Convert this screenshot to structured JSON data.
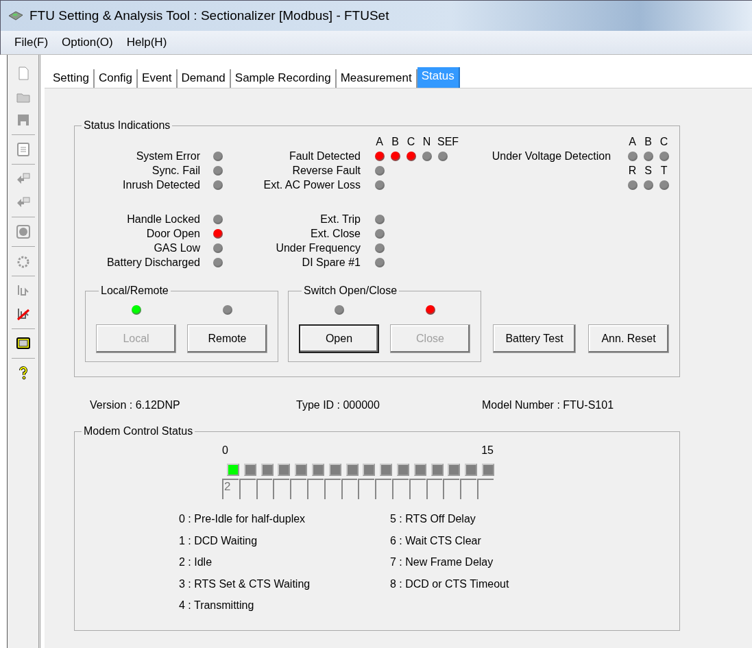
{
  "window": {
    "title": "FTU Setting & Analysis Tool : Sectionalizer [Modbus]  - FTUSet"
  },
  "menu": [
    "File(F)",
    "Option(O)",
    "Help(H)"
  ],
  "tabs": [
    {
      "label": "Setting",
      "selected": false
    },
    {
      "label": "Config",
      "selected": false
    },
    {
      "label": "Event",
      "selected": false
    },
    {
      "label": "Demand",
      "selected": false
    },
    {
      "label": "Sample Recording",
      "selected": false
    },
    {
      "label": "Measurement",
      "selected": false
    },
    {
      "label": "Status",
      "selected": true
    }
  ],
  "status_indications": {
    "title": "Status Indications",
    "left_top": [
      {
        "label": "System Error",
        "color": "#8a8a8a"
      },
      {
        "label": "Sync. Fail",
        "color": "#8a8a8a"
      },
      {
        "label": "Inrush Detected",
        "color": "#8a8a8a"
      }
    ],
    "left_bottom": [
      {
        "label": "Handle Locked",
        "color": "#8a8a8a"
      },
      {
        "label": "Door Open",
        "color": "#ff0000"
      },
      {
        "label": "GAS Low",
        "color": "#8a8a8a"
      },
      {
        "label": "Battery Discharged",
        "color": "#8a8a8a"
      }
    ],
    "phase_headers": [
      "A",
      "B",
      "C",
      "N",
      "SEF"
    ],
    "middle_top": [
      {
        "label": "Fault Detected",
        "leds": [
          {
            "color": "#ff0000"
          },
          {
            "color": "#ff0000"
          },
          {
            "color": "#ff0000"
          },
          {
            "color": "#8a8a8a"
          },
          {
            "color": "#8a8a8a"
          }
        ]
      },
      {
        "label": "Reverse Fault",
        "leds": [
          {
            "color": "#8a8a8a"
          }
        ]
      },
      {
        "label": "Ext. AC Power Loss",
        "leds": [
          {
            "color": "#8a8a8a"
          }
        ]
      }
    ],
    "middle_bottom": [
      {
        "label": "Ext. Trip",
        "color": "#8a8a8a"
      },
      {
        "label": "Ext. Close",
        "color": "#8a8a8a"
      },
      {
        "label": "Under Frequency",
        "color": "#8a8a8a"
      },
      {
        "label": "DI Spare #1",
        "color": "#8a8a8a"
      }
    ],
    "under_voltage": {
      "label": "Under Voltage Detection",
      "headers_1": [
        "A",
        "B",
        "C"
      ],
      "leds_1": [
        {
          "color": "#8a8a8a"
        },
        {
          "color": "#8a8a8a"
        },
        {
          "color": "#8a8a8a"
        }
      ],
      "headers_2": [
        "R",
        "S",
        "T"
      ],
      "leds_2": [
        {
          "color": "#8a8a8a"
        },
        {
          "color": "#8a8a8a"
        },
        {
          "color": "#8a8a8a"
        }
      ]
    },
    "local_remote": {
      "title": "Local/Remote",
      "items": [
        {
          "label": "Local",
          "color": "#00ff00",
          "disabled": true,
          "default": false
        },
        {
          "label": "Remote",
          "color": "#8a8a8a",
          "disabled": false,
          "default": false
        }
      ]
    },
    "switch": {
      "title": "Switch Open/Close",
      "items": [
        {
          "label": "Open",
          "color": "#8a8a8a",
          "disabled": false,
          "default": true
        },
        {
          "label": "Close",
          "color": "#ff0000",
          "disabled": true,
          "default": false
        }
      ]
    },
    "buttons": [
      "Battery Test",
      "Ann. Reset"
    ]
  },
  "info": [
    "Version : 6.12DNP",
    "Type ID : 000000",
    "Model Number : FTU-S101"
  ],
  "modem": {
    "title": "Modem Control Status",
    "scale_start": "0",
    "scale_end": "15",
    "leds": [
      true,
      false,
      false,
      false,
      false,
      false,
      false,
      false,
      false,
      false,
      false,
      false,
      false,
      false,
      false,
      false
    ],
    "boxes": [
      "2"
    ],
    "legend_left": [
      "0 : Pre-Idle for half-duplex",
      "1 : DCD Waiting",
      "2 : Idle",
      "3 : RTS Set & CTS Waiting",
      "4 : Transmitting"
    ],
    "legend_right": [
      "5 : RTS Off Delay",
      "6 : Wait CTS Clear",
      "7 : New Frame Delay",
      "8 : DCD or CTS Timeout"
    ]
  }
}
